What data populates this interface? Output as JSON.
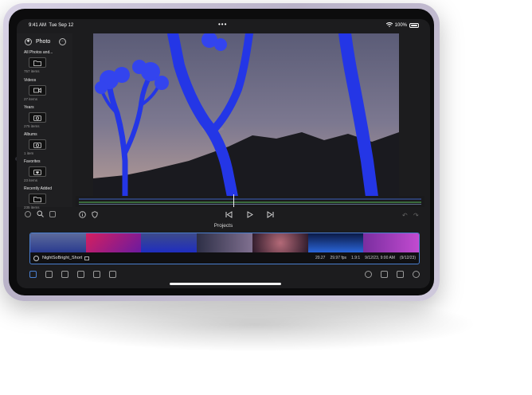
{
  "status": {
    "time": "9:41 AM",
    "date": "Tue Sep 12",
    "battery": "100%"
  },
  "sidebar": {
    "title": "Photo",
    "sections": [
      {
        "label": "All Photos and...",
        "count": "757 items"
      },
      {
        "label": "Videos",
        "count": "27 items"
      },
      {
        "label": "Years",
        "count": "275 items"
      },
      {
        "label": "Albums",
        "count": "1 item"
      },
      {
        "label": "Favorites",
        "count": "23 items"
      },
      {
        "label": "Recently Added",
        "count": "235 items"
      }
    ]
  },
  "projects": {
    "label": "Projects",
    "clip_name": "NightSoBright_Short",
    "duration": "20.27",
    "fps": "29.97 fps",
    "ratio": "1.9:1",
    "date": "9/12/23, 9:00 AM",
    "date_paren": "(9/12/23)"
  },
  "colors": {
    "accent": "#4a7fd0",
    "screen_bg": "#1c1c1e",
    "tree": "#2a3be0"
  },
  "icons": [
    "settings-icon",
    "more-icon",
    "folder-icon",
    "video-icon",
    "camera-icon",
    "heart-icon",
    "info-icon",
    "shield-icon",
    "skip-back-icon",
    "play-icon",
    "skip-forward-icon",
    "search-icon",
    "share-icon",
    "help-icon"
  ]
}
